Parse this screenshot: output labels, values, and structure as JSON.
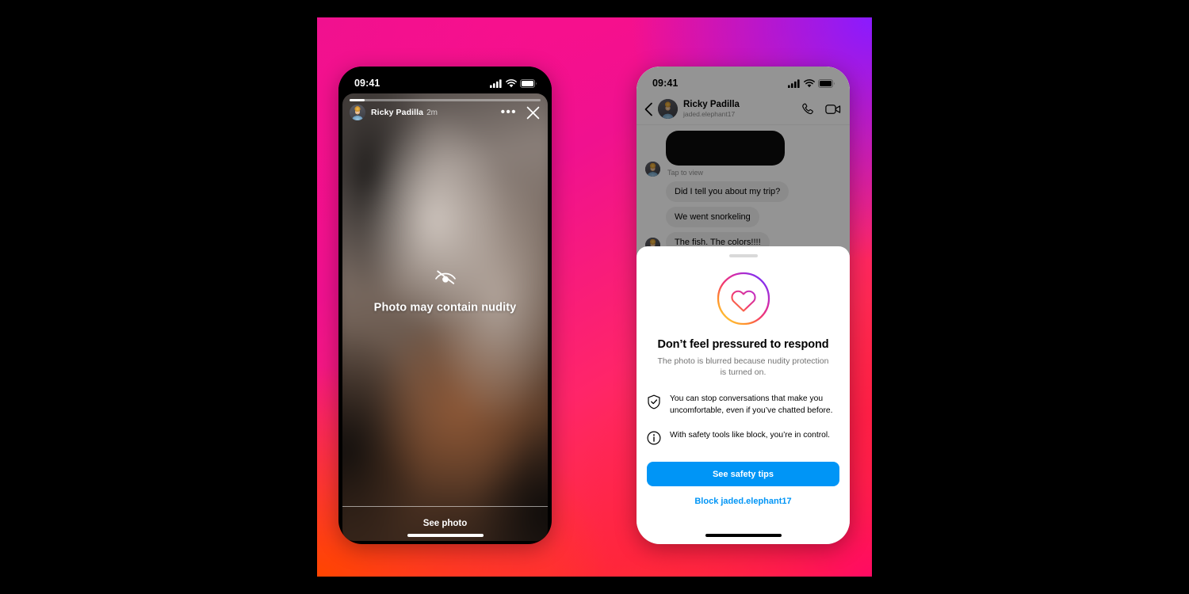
{
  "background": {
    "colors": {
      "top_left": "#F0118F",
      "top_right": "#8A1BFF",
      "bottom_left": "#FF5A00",
      "bottom_right": "#FF0A63"
    }
  },
  "left_phone": {
    "status_bar": {
      "time": "09:41",
      "icons": [
        "cellular-signal-icon",
        "wifi-icon",
        "battery-icon"
      ]
    },
    "story": {
      "author_name": "Ricky Padilla",
      "timestamp": "2m",
      "progress_percent": 8,
      "more_options_label": "•••",
      "close_label": "Close",
      "warning_icon": "eye-off-icon",
      "warning_text": "Photo may contain nudity",
      "see_photo_label": "See photo"
    }
  },
  "right_phone": {
    "status_bar": {
      "time": "09:41",
      "icons": [
        "cellular-signal-icon",
        "wifi-icon",
        "battery-icon"
      ]
    },
    "conversation": {
      "title": "Ricky Padilla",
      "username": "jaded.elephant17",
      "back_label": "Back",
      "call_label": "Audio call",
      "video_label": "Video call",
      "messages": [
        {
          "type": "media",
          "caption": "Tap to view",
          "incoming": true
        },
        {
          "type": "text",
          "text": "Did I tell you about my trip?",
          "incoming": true
        },
        {
          "type": "text",
          "text": "We went snorkeling",
          "incoming": true
        },
        {
          "type": "text",
          "text": "The fish. The colors!!!!",
          "incoming": true
        }
      ]
    },
    "sheet": {
      "icon": "heart-in-circle-gradient-icon",
      "title": "Don’t feel pressured to respond",
      "subtitle": "The photo is blurred because nudity protection is turned on.",
      "points": [
        {
          "icon": "shield-check-icon",
          "text": "You can stop conversations that make you uncomfortable, even if you’ve chatted before."
        },
        {
          "icon": "info-circle-icon",
          "text": "With safety tools like block, you’re in control."
        }
      ],
      "primary_button": "See safety tips",
      "secondary_button": "Block jaded.elephant17",
      "accent_color": "#0095F6"
    }
  }
}
